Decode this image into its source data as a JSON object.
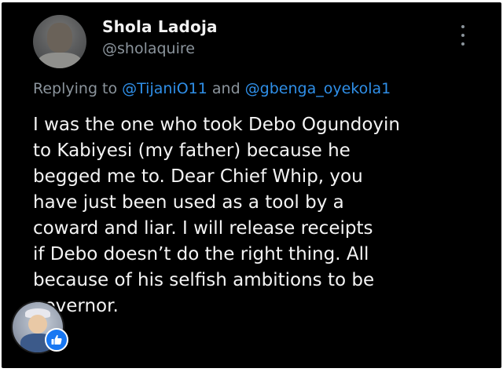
{
  "author": {
    "display_name": "Shola Ladoja",
    "handle": "@sholaquire"
  },
  "reply": {
    "prefix": "Replying to ",
    "mention_1": "@TijaniO11",
    "joiner": " and ",
    "mention_2": "@gbenga_oyekola1"
  },
  "tweet": {
    "lines": [
      "I was the one who took Debo Ogundoyin",
      "to Kabiyesi (my father) because he",
      "begged me to. Dear Chief Whip, you",
      "have just been used as a tool by a",
      "coward and liar. I will release receipts",
      "if Debo doesn’t do the right thing. All",
      "because of his selfish ambitions to be",
      "governor."
    ]
  },
  "icons": {
    "more": "more-vertical-icon",
    "reaction": "thumbs-up-icon"
  },
  "colors": {
    "background": "#000000",
    "name": "#f2f2f2",
    "secondary": "#8b949c",
    "mention": "#2f8fe8",
    "body_text": "#f4f4f4",
    "like_badge": "#1877f2"
  }
}
